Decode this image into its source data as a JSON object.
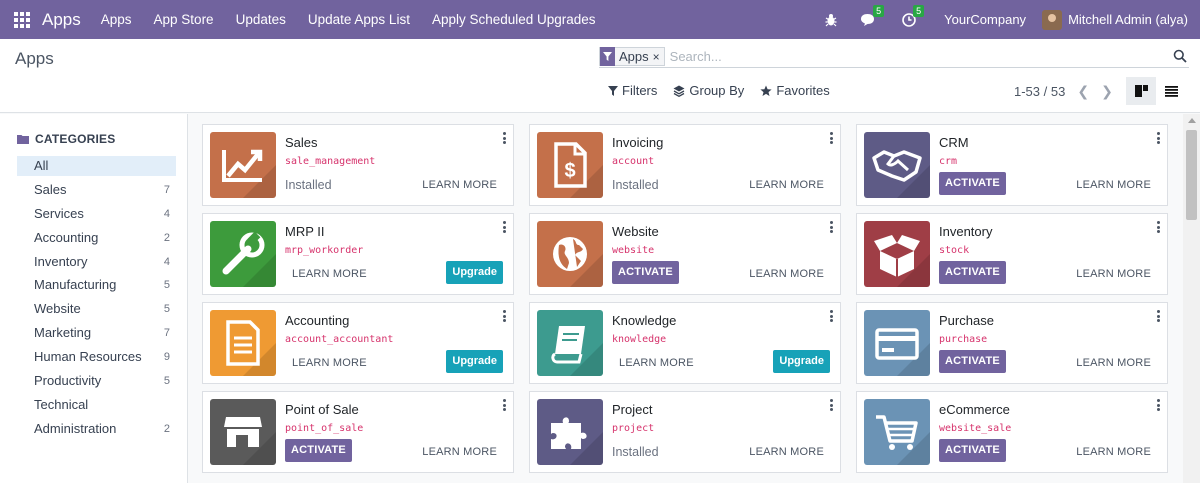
{
  "navbar": {
    "brand": "Apps",
    "menu": [
      "Apps",
      "App Store",
      "Updates",
      "Update Apps List",
      "Apply Scheduled Upgrades"
    ],
    "messages_count": "5",
    "activities_count": "5",
    "company": "YourCompany",
    "user": "Mitchell Admin (alya)"
  },
  "control_panel": {
    "title": "Apps",
    "facet_label": "Apps",
    "facet_close": "×",
    "search_placeholder": "Search...",
    "filters_label": "Filters",
    "group_by_label": "Group By",
    "favorites_label": "Favorites",
    "pager": "1-53 / 53"
  },
  "sidebar": {
    "header": "CATEGORIES",
    "items": [
      {
        "label": "All",
        "count": ""
      },
      {
        "label": "Sales",
        "count": "7"
      },
      {
        "label": "Services",
        "count": "4"
      },
      {
        "label": "Accounting",
        "count": "2"
      },
      {
        "label": "Inventory",
        "count": "4"
      },
      {
        "label": "Manufacturing",
        "count": "5"
      },
      {
        "label": "Website",
        "count": "5"
      },
      {
        "label": "Marketing",
        "count": "7"
      },
      {
        "label": "Human Resources",
        "count": "9"
      },
      {
        "label": "Productivity",
        "count": "5"
      },
      {
        "label": "Technical",
        "count": ""
      },
      {
        "label": "Administration",
        "count": "2"
      }
    ]
  },
  "apps": [
    {
      "name": "Sales",
      "technical": "sale_management",
      "status": "Installed",
      "learn": "LEARN MORE",
      "icon": "sales-chart-icon",
      "color": "#c4704a"
    },
    {
      "name": "Invoicing",
      "technical": "account",
      "status": "Installed",
      "learn": "LEARN MORE",
      "icon": "invoice-icon",
      "color": "#c4704a"
    },
    {
      "name": "CRM",
      "technical": "crm",
      "activate": "ACTIVATE",
      "learn": "LEARN MORE",
      "icon": "handshake-icon",
      "color": "#5e5b86"
    },
    {
      "name": "MRP II",
      "technical": "mrp_workorder",
      "learn": "LEARN MORE",
      "upgrade": "Upgrade",
      "icon": "wrench-icon",
      "color": "#3d9b3c"
    },
    {
      "name": "Website",
      "technical": "website",
      "activate": "ACTIVATE",
      "learn": "LEARN MORE",
      "icon": "globe-icon",
      "color": "#c4704a"
    },
    {
      "name": "Inventory",
      "technical": "stock",
      "activate": "ACTIVATE",
      "learn": "LEARN MORE",
      "icon": "box-icon",
      "color": "#9f3e46"
    },
    {
      "name": "Accounting",
      "technical": "account_accountant",
      "learn": "LEARN MORE",
      "upgrade": "Upgrade",
      "icon": "document-icon",
      "color": "#ef9a33"
    },
    {
      "name": "Knowledge",
      "technical": "knowledge",
      "learn": "LEARN MORE",
      "upgrade": "Upgrade",
      "icon": "book-icon",
      "color": "#3d9b8f"
    },
    {
      "name": "Purchase",
      "technical": "purchase",
      "activate": "ACTIVATE",
      "learn": "LEARN MORE",
      "icon": "credit-card-icon",
      "color": "#6b93b5"
    },
    {
      "name": "Point of Sale",
      "technical": "point_of_sale",
      "activate": "ACTIVATE",
      "learn": "LEARN MORE",
      "icon": "shop-icon",
      "color": "#5a5a5a"
    },
    {
      "name": "Project",
      "technical": "project",
      "status": "Installed",
      "learn": "LEARN MORE",
      "icon": "puzzle-icon",
      "color": "#5e5b86"
    },
    {
      "name": "eCommerce",
      "technical": "website_sale",
      "activate": "ACTIVATE",
      "learn": "LEARN MORE",
      "icon": "cart-icon",
      "color": "#6b93b5"
    }
  ]
}
